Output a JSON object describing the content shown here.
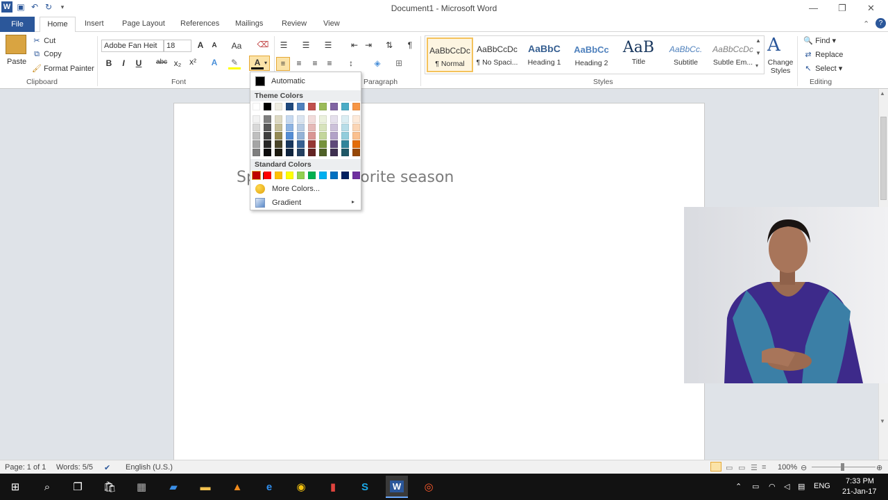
{
  "window": {
    "title": "Document1 - Microsoft Word"
  },
  "tabs": [
    "File",
    "Home",
    "Insert",
    "Page Layout",
    "References",
    "Mailings",
    "Review",
    "View"
  ],
  "clipboard": {
    "paste": "Paste",
    "cut": "Cut",
    "copy": "Copy",
    "format_painter": "Format Painter",
    "label": "Clipboard"
  },
  "font": {
    "name": "Adobe Fan Heit",
    "size": "18",
    "label": "Font"
  },
  "paragraph": {
    "label": "Paragraph"
  },
  "styles": {
    "label": "Styles",
    "items": [
      {
        "preview": "AaBbCcDc",
        "name": "¶ Normal"
      },
      {
        "preview": "AaBbCcDc",
        "name": "¶ No Spaci..."
      },
      {
        "preview": "AaBbC",
        "name": "Heading 1"
      },
      {
        "preview": "AaBbCc",
        "name": "Heading 2"
      },
      {
        "preview": "AaB",
        "name": "Title"
      },
      {
        "preview": "AaBbCc.",
        "name": "Subtitle"
      },
      {
        "preview": "AaBbCcDc",
        "name": "Subtle Em..."
      }
    ],
    "change_styles": "Change Styles"
  },
  "editing": {
    "find": "Find",
    "replace": "Replace",
    "select": "Select",
    "label": "Editing"
  },
  "document": {
    "text": "Spring is my favorite season"
  },
  "color_menu": {
    "automatic": "Automatic",
    "theme_header": "Theme Colors",
    "standard_header": "Standard Colors",
    "more_colors": "More Colors...",
    "gradient": "Gradient",
    "theme_top": [
      "#ffffff",
      "#000000",
      "#eeece1",
      "#1f497d",
      "#4f81bd",
      "#c0504d",
      "#9bbb59",
      "#8064a2",
      "#4bacc6",
      "#f79646"
    ],
    "theme_shades": [
      [
        "#f2f2f2",
        "#7f7f7f",
        "#ddd9c3",
        "#c6d9f0",
        "#dbe5f1",
        "#f2dcdb",
        "#ebf1dd",
        "#e5e0ec",
        "#dbeef3",
        "#fdeada"
      ],
      [
        "#d8d8d8",
        "#595959",
        "#c4bd97",
        "#8db3e2",
        "#b8cce4",
        "#e5b9b7",
        "#d7e3bc",
        "#ccc1d9",
        "#b7dde8",
        "#fbd5b5"
      ],
      [
        "#bfbfbf",
        "#3f3f3f",
        "#938953",
        "#548dd4",
        "#95b3d7",
        "#d99694",
        "#c3d69b",
        "#b2a2c7",
        "#92cddc",
        "#fac08f"
      ],
      [
        "#a5a5a5",
        "#262626",
        "#494429",
        "#17365d",
        "#366092",
        "#953734",
        "#76923c",
        "#5f497a",
        "#31859b",
        "#e36c09"
      ],
      [
        "#7f7f7f",
        "#0c0c0c",
        "#1d1b10",
        "#0f243e",
        "#244061",
        "#632423",
        "#4f6128",
        "#3f3151",
        "#205867",
        "#974806"
      ]
    ],
    "standard": [
      "#c00000",
      "#ff0000",
      "#ffc000",
      "#ffff00",
      "#92d050",
      "#00b050",
      "#00b0f0",
      "#0070c0",
      "#002060",
      "#7030a0"
    ]
  },
  "status": {
    "page": "Page: 1 of 1",
    "words": "Words: 5/5",
    "language": "English (U.S.)",
    "zoom": "100%"
  },
  "taskbar": {
    "lang": "ENG",
    "time": "7:33 PM",
    "date": "21-Jan-17"
  },
  "colors": {
    "accent": "#2b579a",
    "file_tab": "#2b579a",
    "highlight": "#f4c25b"
  }
}
